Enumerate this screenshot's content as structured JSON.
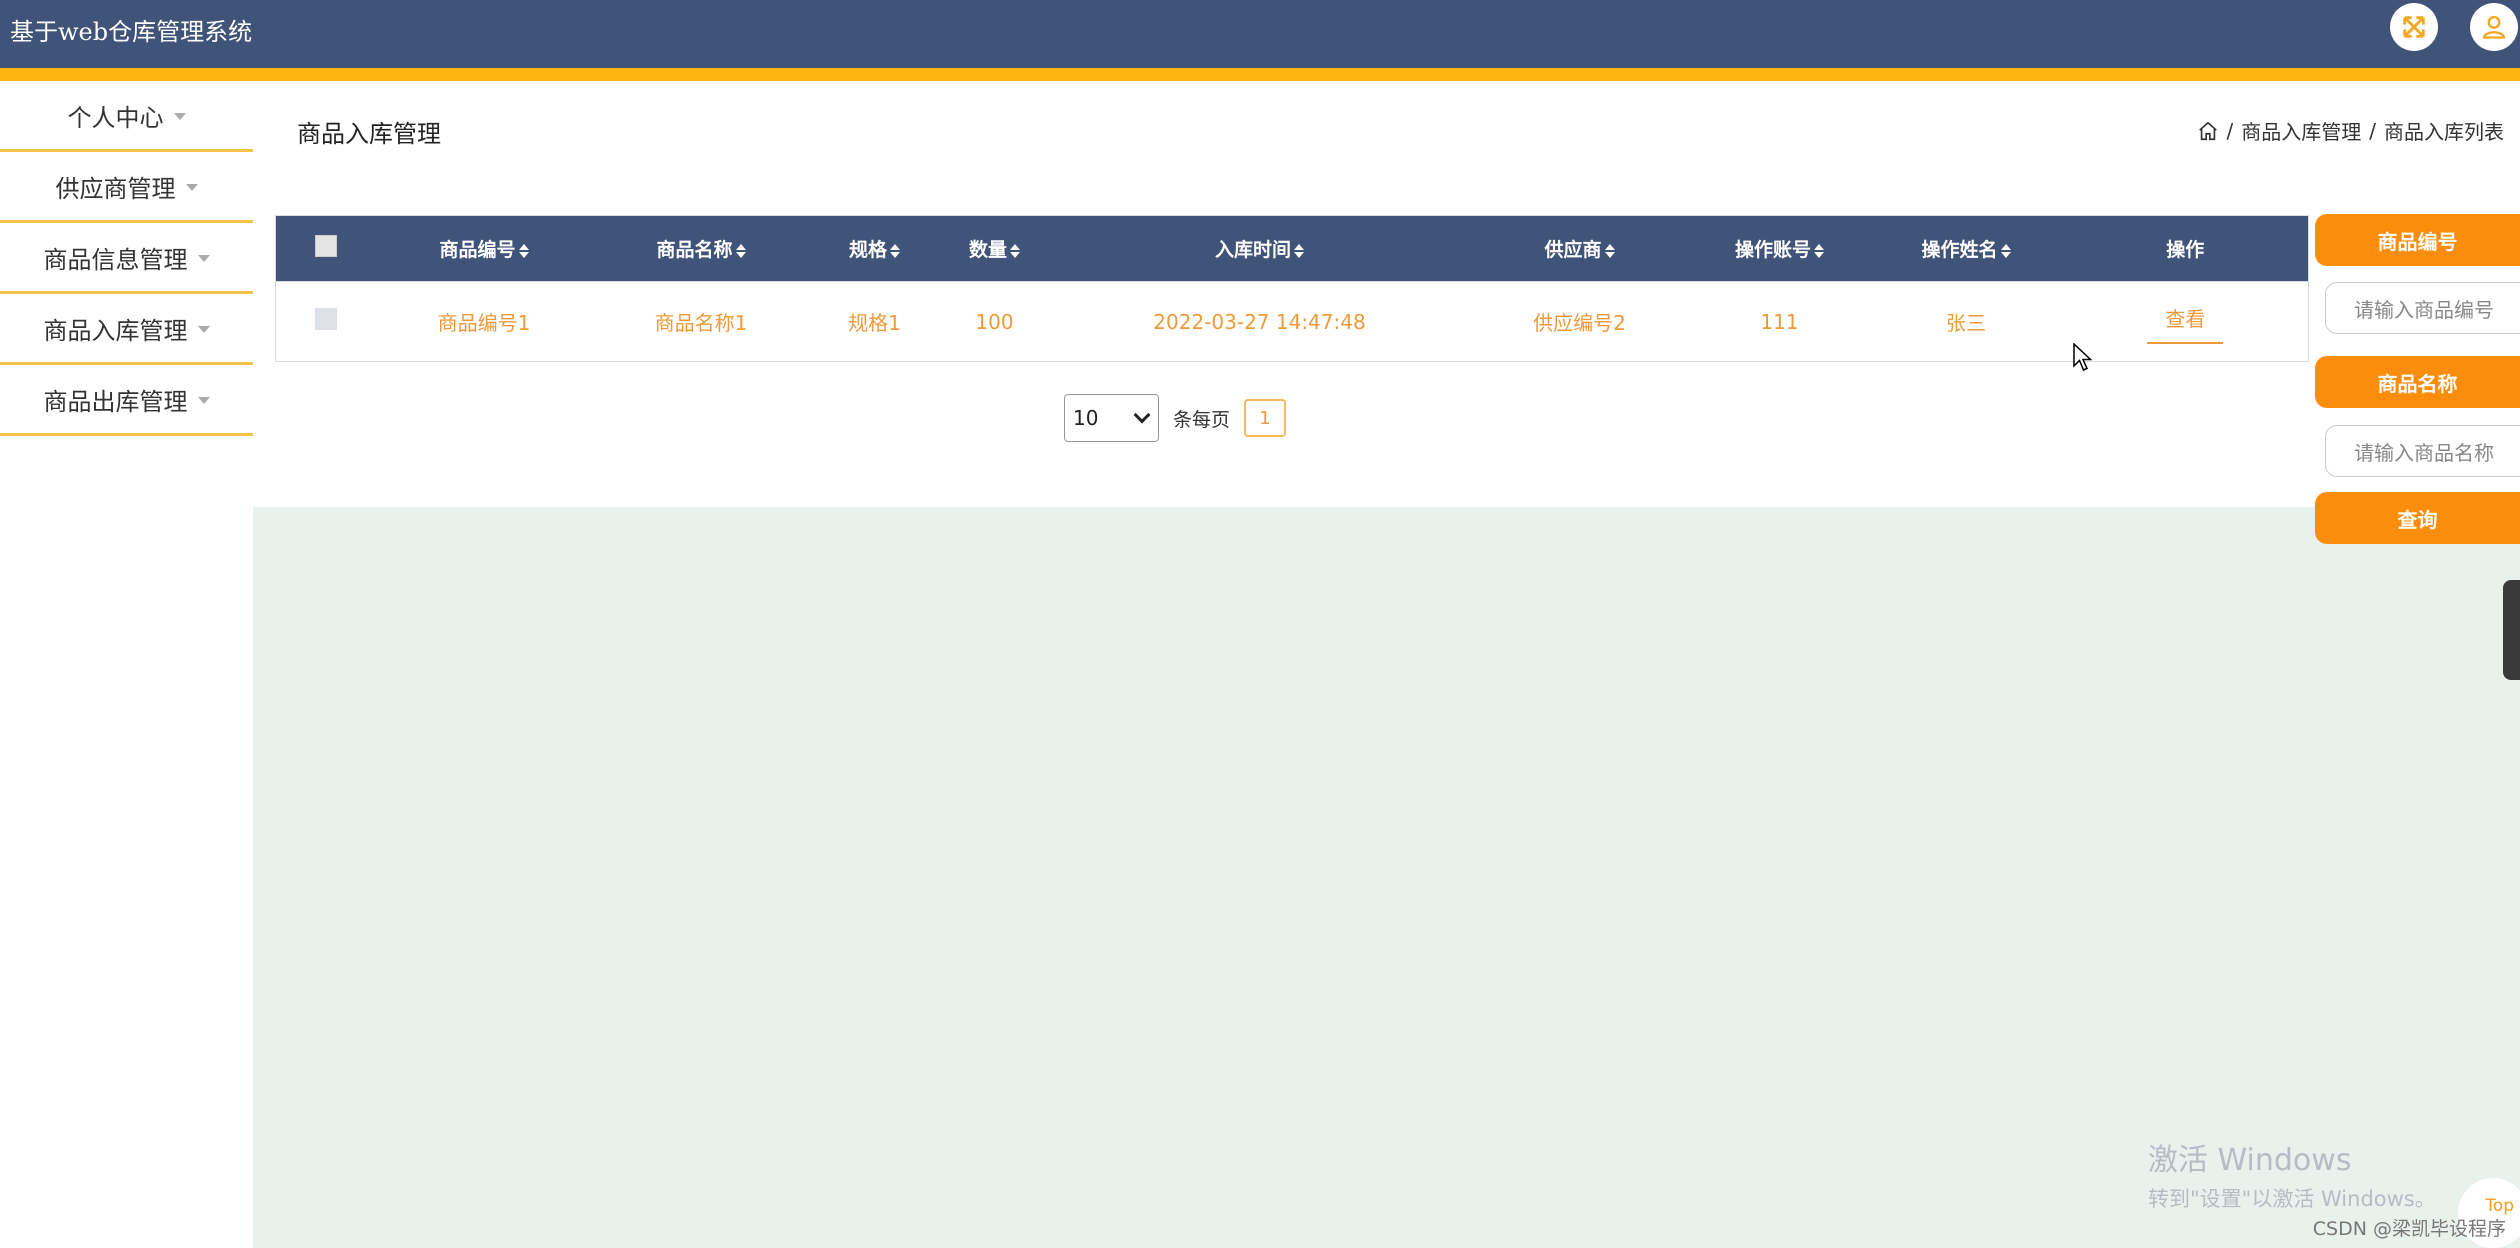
{
  "app": {
    "title": "基于web仓库管理系统"
  },
  "header": {
    "fullscreen_icon": "expand-arrows-icon",
    "user_icon": "user-icon"
  },
  "sidebar": {
    "items": [
      {
        "label": "个人中心"
      },
      {
        "label": "供应商管理"
      },
      {
        "label": "商品信息管理"
      },
      {
        "label": "商品入库管理"
      },
      {
        "label": "商品出库管理"
      }
    ]
  },
  "page": {
    "title": "商品入库管理",
    "breadcrumb": [
      "商品入库管理",
      "商品入库列表"
    ],
    "separator": "/"
  },
  "table": {
    "columns": [
      "商品编号",
      "商品名称",
      "规格",
      "数量",
      "入库时间",
      "供应商",
      "操作账号",
      "操作姓名",
      "操作"
    ],
    "rows": [
      {
        "code": "商品编号1",
        "name": "商品名称1",
        "spec": "规格1",
        "qty": "100",
        "time": "2022-03-27 14:47:48",
        "supplier": "供应编号2",
        "account": "111",
        "operator": "张三",
        "action": "查看"
      }
    ]
  },
  "pagination": {
    "page_size": "10",
    "per_page_label": "条每页",
    "current_page": "1"
  },
  "search": {
    "code_label": "商品编号",
    "code_placeholder": "请输入商品编号",
    "name_label": "商品名称",
    "name_placeholder": "请输入商品名称",
    "query_label": "查询"
  },
  "overlay": {
    "watermark_line1": "激活 Windows",
    "watermark_line2": "转到\"设置\"以激活 Windows。",
    "top_label": "Top",
    "credit": "CSDN @梁凯毕设程序"
  },
  "colors": {
    "header": "#405378",
    "accent_stripe": "#fbb510",
    "orange": "#fb8d0c",
    "text_orange": "#ef9a3a"
  }
}
